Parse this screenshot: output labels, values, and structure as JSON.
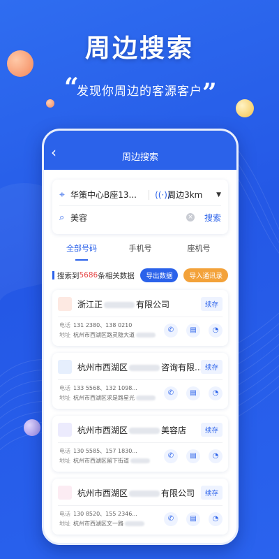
{
  "hero": {
    "title": "周边搜索",
    "subtitle": "发现你周边的客源客户",
    "quote_open": "“",
    "quote_close": "”"
  },
  "colors": {
    "primary": "#2b62ea",
    "accent_orange": "#f3a23a",
    "count_red": "#e64545"
  },
  "header": {
    "back_icon": "chevron-left-icon",
    "title": "周边搜索"
  },
  "search": {
    "location": "华策中心B座13...",
    "range": "周边3km",
    "query": "美容",
    "search_label": "搜索"
  },
  "tabs": [
    {
      "label": "全部号码",
      "active": true
    },
    {
      "label": "手机号",
      "active": false
    },
    {
      "label": "座机号",
      "active": false
    }
  ],
  "results": {
    "prefix": "搜索到",
    "count": "5686",
    "suffix": "条相关数据",
    "export_label": "导出数据",
    "import_label": "导入通讯录"
  },
  "cards": [
    {
      "name_a": "浙江正",
      "name_b": "有限公司",
      "follow": "续存",
      "phone_key": "电话",
      "phone": "131 2380、138 0210",
      "addr_key": "地址",
      "addr": "杭州市西湖区路灵隐大道",
      "logo_color": "#fde9e2"
    },
    {
      "name_a": "杭州市西湖区",
      "name_b": "咨询有限...",
      "follow": "续存",
      "phone_key": "电话",
      "phone": "133 5568、132 1098...",
      "addr_key": "地址",
      "addr": "杭州市西湖区求是路星光",
      "logo_color": "#e6effd"
    },
    {
      "name_a": "杭州市西湖区",
      "name_b": "美容店",
      "follow": "续存",
      "phone_key": "电话",
      "phone": "130 5585、157 1830...",
      "addr_key": "地址",
      "addr": "杭州市西湖区留下街道",
      "logo_color": "#ecebfd"
    },
    {
      "name_a": "杭州市西湖区",
      "name_b": "有限公司",
      "follow": "续存",
      "phone_key": "电话",
      "phone": "130 8520、155 2346...",
      "addr_key": "地址",
      "addr": "杭州市西湖区文一路",
      "logo_color": "#fcecf3"
    }
  ]
}
